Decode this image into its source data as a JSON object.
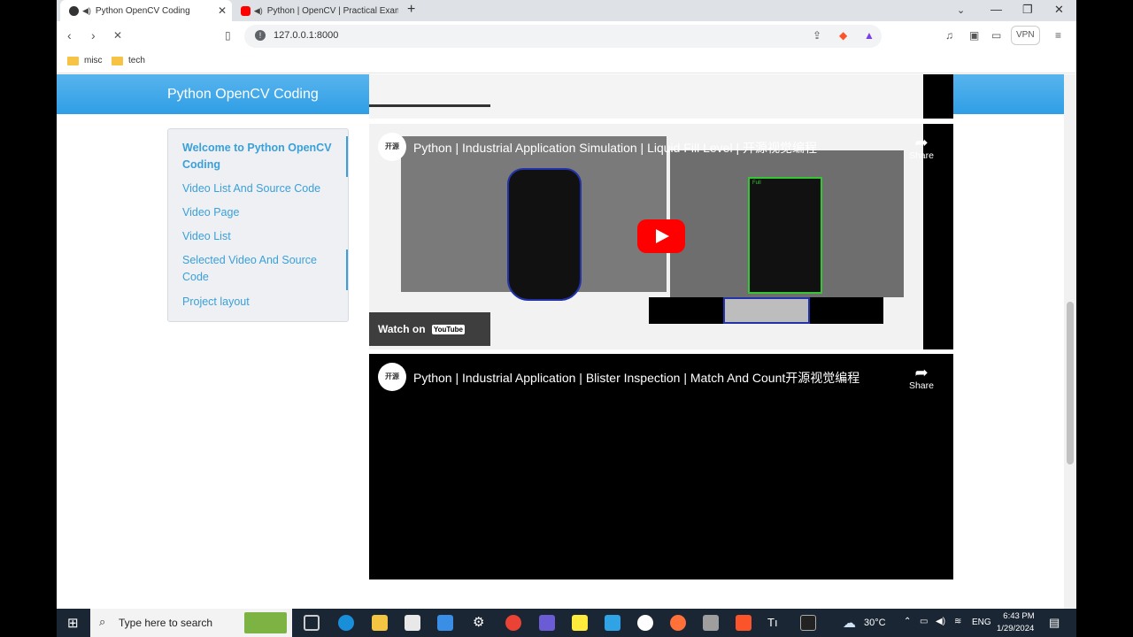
{
  "browser": {
    "tabs": [
      {
        "title": "Python OpenCV Coding",
        "active": true
      },
      {
        "title": "Python | OpenCV | Practical Examp",
        "active": false
      }
    ],
    "url": "127.0.0.1:8000",
    "vpn_label": "VPN",
    "bookmarks": [
      "misc",
      "tech"
    ]
  },
  "page": {
    "brand": "Python OpenCV Coding",
    "sidebar": [
      "Welcome to Python OpenCV Coding",
      "Video List And Source Code",
      "Video Page",
      "Video List",
      "Selected Video And Source Code",
      "Project layout"
    ],
    "videos": [
      {
        "title": "Python | Industrial Application Simulation | Liquid Fill Level | 开源视觉编程",
        "share": "Share",
        "watch_on": "Watch on",
        "yt_label": "YouTube"
      },
      {
        "title": "Python | Industrial Application | Blister Inspection | Match And Count开源视觉编程",
        "share": "Share"
      }
    ],
    "overlay_label": "Full"
  },
  "taskbar": {
    "search_placeholder": "Type here to search",
    "weather": "30°C",
    "lang": "ENG",
    "time": "6:43 PM",
    "date": "1/29/2024"
  },
  "colors": {
    "header": "#2f9ee5",
    "link": "#3aa0d8",
    "play": "#ff0000"
  }
}
